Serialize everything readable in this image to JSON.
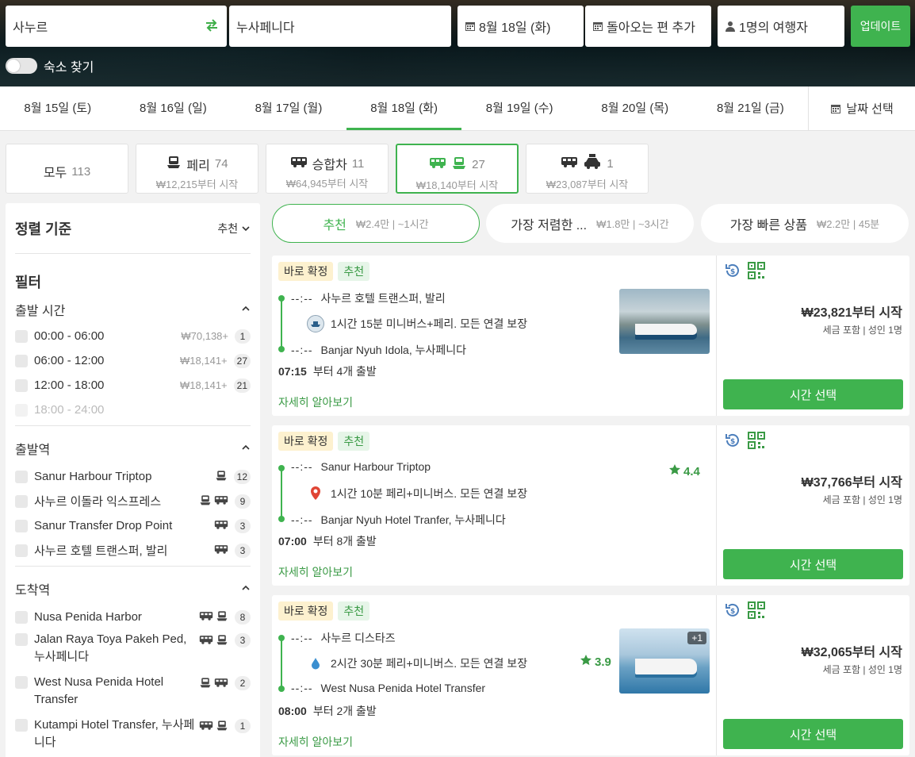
{
  "search": {
    "from": "사누르",
    "to": "누사페니다",
    "date": "8월 18일 (화)",
    "return": "돌아오는 편 추가",
    "travelers": "1명의 여행자",
    "update": "업데이트",
    "accommodation_toggle": "숙소 찾기"
  },
  "date_tabs": [
    {
      "label": "8월 15일 (토)"
    },
    {
      "label": "8월 16일 (일)"
    },
    {
      "label": "8월 17일 (월)"
    },
    {
      "label": "8월 18일 (화)"
    },
    {
      "label": "8월 19일 (수)"
    },
    {
      "label": "8월 20일 (목)"
    },
    {
      "label": "8월 21일 (금)"
    }
  ],
  "date_picker": "날짜 선택",
  "categories": [
    {
      "label": "모두",
      "count": "113",
      "price": ""
    },
    {
      "label": "페리",
      "count": "74",
      "price": "₩12,215부터 시작"
    },
    {
      "label": "승합차",
      "count": "11",
      "price": "₩64,945부터 시작"
    },
    {
      "label": "",
      "count": "27",
      "price": "₩18,140부터 시작"
    },
    {
      "label": "",
      "count": "1",
      "price": "₩23,087부터 시작"
    }
  ],
  "sidebar": {
    "sort_title": "정렬 기준",
    "sort_value": "추천",
    "filter_title": "필터",
    "departure_time": {
      "title": "출발 시간",
      "items": [
        {
          "label": "00:00 - 06:00",
          "price": "₩70,138+",
          "count": "1"
        },
        {
          "label": "06:00 - 12:00",
          "price": "₩18,141+",
          "count": "27"
        },
        {
          "label": "12:00 - 18:00",
          "price": "₩18,141+",
          "count": "21"
        },
        {
          "label": "18:00 - 24:00",
          "price": "",
          "count": ""
        }
      ]
    },
    "departure_station": {
      "title": "출발역",
      "items": [
        {
          "label": "Sanur Harbour Triptop",
          "count": "12"
        },
        {
          "label": "사누르 이돌라 익스프레스",
          "count": "9"
        },
        {
          "label": "Sanur Transfer Drop Point",
          "count": "3"
        },
        {
          "label": "사누르 호텔 트랜스퍼, 발리",
          "count": "3"
        }
      ]
    },
    "arrival_station": {
      "title": "도착역",
      "items": [
        {
          "label": "Nusa Penida Harbor",
          "count": "8"
        },
        {
          "label": "Jalan Raya Toya Pakeh Ped, 누사페니다",
          "count": "3"
        },
        {
          "label": "West Nusa Penida Hotel Transfer",
          "count": "2"
        },
        {
          "label": "Kutampi Hotel Transfer, 누사페니다",
          "count": "1"
        }
      ]
    }
  },
  "sort_pills": [
    {
      "label": "추천",
      "meta": "₩2.4만 | ~1시간"
    },
    {
      "label": "가장 저렴한 ...",
      "meta": "₩1.8만 | ~3시간"
    },
    {
      "label": "가장 빠른 상품",
      "meta": "₩2.2만 | 45분"
    }
  ],
  "results": [
    {
      "tag_confirm": "바로 확정",
      "tag_rec": "추천",
      "dep_time": "--:--",
      "from": "사누르 호텔 트랜스퍼, 발리",
      "info": "1시간 15분 미니버스+페리. 모든 연결 보장",
      "arr_time": "--:--",
      "to": "Banjar Nyuh Idola, 누사페니다",
      "first_dep": "07:15",
      "dep_count": "부터 4개 출발",
      "more": "자세히 알아보기",
      "price": "₩23,821부터 시작",
      "price_note": "세금 포함 | 성인 1명",
      "button": "시간 선택"
    },
    {
      "tag_confirm": "바로 확정",
      "tag_rec": "추천",
      "dep_time": "--:--",
      "from": "Sanur Harbour Triptop",
      "info": "1시간 10분 페리+미니버스. 모든 연결 보장",
      "arr_time": "--:--",
      "to": "Banjar Nyuh Hotel Tranfer, 누사페니다",
      "first_dep": "07:00",
      "dep_count": "부터 8개 출발",
      "more": "자세히 알아보기",
      "rating": "4.4",
      "price": "₩37,766부터 시작",
      "price_note": "세금 포함 | 성인 1명",
      "button": "시간 선택"
    },
    {
      "tag_confirm": "바로 확정",
      "tag_rec": "추천",
      "dep_time": "--:--",
      "from": "사누르 디스타즈",
      "info": "2시간 30분 페리+미니버스. 모든 연결 보장",
      "arr_time": "--:--",
      "to": "West Nusa Penida Hotel Transfer",
      "first_dep": "08:00",
      "dep_count": "부터 2개 출발",
      "more": "자세히 알아보기",
      "rating": "3.9",
      "photo_more": "+1",
      "price": "₩32,065부터 시작",
      "price_note": "세금 포함 | 성인 1명",
      "button": "시간 선택"
    }
  ],
  "colors": {
    "accent": "#3fb34f",
    "accent_text": "#3a9a45",
    "tag_yellow": "#fdf1cf"
  }
}
